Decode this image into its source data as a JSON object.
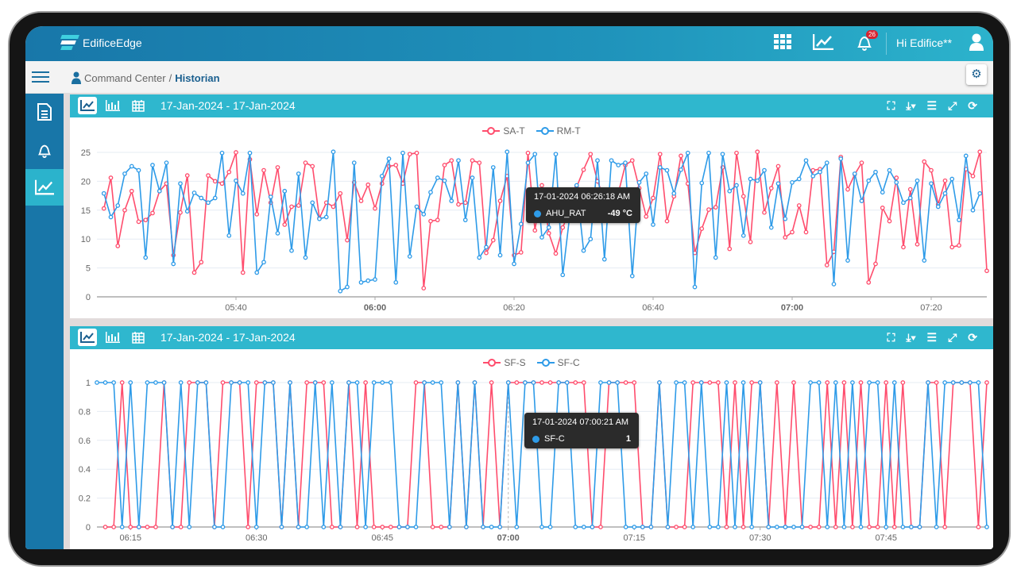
{
  "app": {
    "brand": "EdificeEdge",
    "greeting": "Hi Edifice**",
    "notification_count": "26"
  },
  "breadcrumb": {
    "parent": "Command Center",
    "separator": "/",
    "current": "Historian"
  },
  "colors": {
    "series_red": "#ff4d6d",
    "series_blue": "#2e9be8",
    "header": "#1877a9",
    "panel_header": "#2fb7ce"
  },
  "icons": {
    "topbar": [
      "grid-icon",
      "trend-chart-icon",
      "bell-icon",
      "user-icon"
    ],
    "sidebar": [
      "document-icon",
      "bell-icon",
      "trend-chart-icon"
    ],
    "panel_tools": [
      "fullscreen-icon",
      "download-icon",
      "list-icon",
      "expand-icon",
      "refresh-icon"
    ]
  },
  "panels": [
    {
      "date_range": "17-Jan-2024 - 17-Jan-2024",
      "legend": [
        "SA-T",
        "RM-T"
      ],
      "tooltip": {
        "time": "17-01-2024 06:26:18 AM",
        "series": "AHU_RAT",
        "value": "-49 °C"
      }
    },
    {
      "date_range": "17-Jan-2024 - 17-Jan-2024",
      "legend": [
        "SF-S",
        "SF-C"
      ],
      "tooltip": {
        "time": "17-01-2024 07:00:21 AM",
        "series": "SF-C",
        "value": "1"
      }
    }
  ],
  "chart_data": [
    {
      "type": "line",
      "xlim": [
        "05:20",
        "07:28"
      ],
      "ylim": [
        0,
        25
      ],
      "grid": true,
      "legend_position": "top",
      "yticks": [
        0,
        5,
        10,
        15,
        20,
        25
      ],
      "xticks": [
        "05:40",
        "06:00",
        "06:20",
        "06:40",
        "07:00",
        "07:20"
      ],
      "x": [
        "05:21",
        "05:22",
        "05:23",
        "05:24",
        "05:25",
        "05:26",
        "05:27",
        "05:28",
        "05:29",
        "05:30",
        "05:31",
        "05:32",
        "05:33",
        "05:34",
        "05:35",
        "05:36",
        "05:37",
        "05:38",
        "05:39",
        "05:40",
        "05:41",
        "05:42",
        "05:43",
        "05:44",
        "05:45",
        "05:46",
        "05:47",
        "05:48",
        "05:49",
        "05:50",
        "05:51",
        "05:52",
        "05:53",
        "05:54",
        "05:55",
        "05:56",
        "05:57",
        "05:58",
        "05:59",
        "06:00",
        "06:01",
        "06:02",
        "06:03",
        "06:04",
        "06:05",
        "06:06",
        "06:07",
        "06:08",
        "06:09",
        "06:10",
        "06:11",
        "06:12",
        "06:13",
        "06:14",
        "06:15",
        "06:16",
        "06:17",
        "06:18",
        "06:19",
        "06:20",
        "06:21",
        "06:22",
        "06:23",
        "06:24",
        "06:25",
        "06:26",
        "06:27",
        "06:28",
        "06:29",
        "06:30",
        "06:31",
        "06:32",
        "06:33",
        "06:34",
        "06:35",
        "06:36",
        "06:37",
        "06:38",
        "06:39",
        "06:40",
        "06:41",
        "06:42",
        "06:43",
        "06:44",
        "06:45",
        "06:46",
        "06:47",
        "06:48",
        "06:49",
        "06:50",
        "06:51",
        "06:52",
        "06:53",
        "06:54",
        "06:55",
        "06:56",
        "06:57",
        "06:58",
        "06:59",
        "07:00",
        "07:01",
        "07:02",
        "07:03",
        "07:04",
        "07:05",
        "07:06",
        "07:07",
        "07:08",
        "07:09",
        "07:10",
        "07:11",
        "07:12",
        "07:13",
        "07:14",
        "07:15",
        "07:16",
        "07:17",
        "07:18",
        "07:19",
        "07:20",
        "07:21",
        "07:22",
        "07:23",
        "07:24",
        "07:25",
        "07:26",
        "07:27",
        "07:28"
      ],
      "series": [
        {
          "name": "SA-T",
          "color": "#ff4d6d",
          "values": [
            15.3,
            20.6,
            8.8,
            15,
            18.3,
            13,
            13.3,
            14.5,
            18.3,
            19.6,
            7.2,
            14.6,
            21,
            4.2,
            6,
            21,
            20,
            19.6,
            21.6,
            25,
            4.2,
            23.8,
            14.3,
            21.9,
            16.3,
            22.4,
            12.5,
            15.6,
            15.8,
            23.2,
            22.6,
            13.6,
            16.3,
            15.6,
            17.9,
            9.8,
            19.8,
            16.6,
            19.4,
            15.3,
            19.6,
            22.6,
            22.8,
            19.6,
            24.7,
            24.9,
            1.5,
            13.1,
            13.3,
            22.8,
            23.6,
            16,
            16.3,
            23.6,
            23.2,
            7.6,
            9.8,
            16.6,
            20.9,
            7.2,
            7.7,
            24.9,
            11.5,
            19.3,
            11,
            7.5,
            12,
            15,
            19,
            22,
            24.7,
            20,
            17,
            16,
            18,
            22.8,
            23.6,
            18.8,
            13.9,
            17.1,
            24.7,
            13.1,
            17.4,
            24.4,
            19.6,
            7.6,
            11.8,
            15.1,
            15.5,
            22.4,
            8.3,
            24.9,
            17.4,
            9.5,
            25.1,
            14.6,
            18.8,
            22.6,
            10.3,
            11.2,
            15.8,
            11.2,
            21.9,
            22.1,
            5.5,
            7.8,
            24.2,
            18.6,
            21.2,
            23.2,
            2.5,
            5.7,
            15.4,
            13.1,
            20.6,
            8.6,
            18.6,
            9.1,
            23.4,
            21.9,
            16,
            20.1,
            8.6,
            8.9,
            22.1,
            20.9,
            25.1,
            4.5
          ]
        },
        {
          "name": "RM-T",
          "color": "#2e9be8",
          "values": [
            17.9,
            13.8,
            15.8,
            21.3,
            22.6,
            21.9,
            6.8,
            22.8,
            18.3,
            23.2,
            5.7,
            19.6,
            14.8,
            18,
            17.1,
            16.3,
            17.1,
            24.9,
            10.6,
            20.1,
            17.9,
            24.9,
            4.2,
            6,
            17.3,
            11,
            18.3,
            8,
            21.3,
            6.8,
            16.3,
            13.5,
            13.8,
            25.1,
            1,
            1.7,
            23.2,
            2.5,
            2.8,
            3,
            20.9,
            23.9,
            2.5,
            24.9,
            7,
            15.6,
            14.3,
            18.1,
            20.6,
            20.1,
            16.6,
            23.6,
            13.3,
            20.6,
            6.8,
            8.6,
            22.4,
            7.2,
            25.1,
            5.7,
            12.6,
            23.2,
            24.7,
            10.3,
            12,
            24.7,
            3.8,
            14,
            19.3,
            8,
            10,
            23.6,
            6.5,
            23.6,
            22.8,
            23.2,
            3.6,
            19.8,
            21.3,
            12.5,
            22.4,
            21.9,
            17.9,
            22,
            24.9,
            1.7,
            19.7,
            24.9,
            6.8,
            24.7,
            18.3,
            19.3,
            10.6,
            20.4,
            20.1,
            21.9,
            12,
            19.6,
            13.5,
            19.8,
            20.4,
            23.6,
            20.9,
            21.6,
            23.2,
            2.2,
            23.9,
            6.3,
            21.3,
            16.6,
            20.1,
            21.6,
            18.1,
            21.9,
            19.8,
            16.3,
            17.1,
            20.1,
            6.3,
            19.6,
            15.6,
            17.9,
            20.4,
            13.3,
            24.4,
            15,
            17.9,
            null
          ]
        }
      ]
    },
    {
      "type": "line",
      "xlim": [
        "06:11",
        "07:57"
      ],
      "ylim": [
        0,
        1
      ],
      "grid": true,
      "legend_position": "top",
      "yticks": [
        0,
        0.2,
        0.4,
        0.6,
        0.8,
        1
      ],
      "xticks": [
        "06:15",
        "06:30",
        "06:45",
        "07:00",
        "07:15",
        "07:30",
        "07:45"
      ],
      "x": [
        "06:11",
        "06:12",
        "06:13",
        "06:14",
        "06:15",
        "06:16",
        "06:17",
        "06:18",
        "06:19",
        "06:20",
        "06:21",
        "06:22",
        "06:23",
        "06:24",
        "06:25",
        "06:26",
        "06:27",
        "06:28",
        "06:29",
        "06:30",
        "06:31",
        "06:32",
        "06:33",
        "06:34",
        "06:35",
        "06:36",
        "06:37",
        "06:38",
        "06:39",
        "06:40",
        "06:41",
        "06:42",
        "06:43",
        "06:44",
        "06:45",
        "06:46",
        "06:47",
        "06:48",
        "06:49",
        "06:50",
        "06:51",
        "06:52",
        "06:53",
        "06:54",
        "06:55",
        "06:56",
        "06:57",
        "06:58",
        "06:59",
        "07:00",
        "07:01",
        "07:02",
        "07:03",
        "07:04",
        "07:05",
        "07:06",
        "07:07",
        "07:08",
        "07:09",
        "07:10",
        "07:11",
        "07:12",
        "07:13",
        "07:14",
        "07:15",
        "07:16",
        "07:17",
        "07:18",
        "07:19",
        "07:20",
        "07:21",
        "07:22",
        "07:23",
        "07:24",
        "07:25",
        "07:26",
        "07:27",
        "07:28",
        "07:29",
        "07:30",
        "07:31",
        "07:32",
        "07:33",
        "07:34",
        "07:35",
        "07:36",
        "07:37",
        "07:38",
        "07:39",
        "07:40",
        "07:41",
        "07:42",
        "07:43",
        "07:44",
        "07:45",
        "07:46",
        "07:47",
        "07:48",
        "07:49",
        "07:50",
        "07:51",
        "07:52",
        "07:53",
        "07:54",
        "07:55",
        "07:56",
        "07:57"
      ],
      "series": [
        {
          "name": "SF-S",
          "color": "#ff4d6d",
          "values": [
            null,
            0,
            0,
            1,
            0,
            0,
            0,
            0,
            1,
            0,
            0,
            1,
            1,
            1,
            0,
            1,
            1,
            1,
            0,
            1,
            1,
            1,
            0,
            1,
            0,
            1,
            1,
            1,
            0,
            0,
            1,
            0,
            1,
            0,
            0,
            0,
            0,
            0,
            1,
            1,
            0,
            0,
            0,
            1,
            0,
            1,
            0,
            1,
            0,
            1,
            1,
            1,
            1,
            1,
            1,
            1,
            1,
            1,
            1,
            0,
            0,
            1,
            1,
            1,
            1,
            0,
            0,
            1,
            0,
            0,
            0,
            1,
            1,
            1,
            1,
            0,
            1,
            0,
            1,
            1,
            0,
            1,
            0,
            1,
            0,
            0,
            0,
            1,
            0,
            1,
            0,
            1,
            0,
            0,
            1,
            0,
            1,
            0,
            0,
            1,
            1,
            0,
            1,
            1,
            1,
            0,
            1
          ]
        },
        {
          "name": "SF-C",
          "color": "#2e9be8",
          "values": [
            1,
            1,
            1,
            0,
            1,
            0,
            1,
            1,
            1,
            0,
            1,
            0,
            1,
            1,
            0,
            0,
            1,
            1,
            1,
            0,
            1,
            1,
            0,
            1,
            0,
            0,
            1,
            0,
            1,
            0,
            1,
            1,
            0,
            1,
            1,
            1,
            0,
            0,
            0,
            1,
            1,
            1,
            0,
            1,
            0,
            1,
            0,
            0,
            0,
            1,
            0,
            1,
            1,
            0,
            0,
            1,
            1,
            0,
            0,
            0,
            1,
            1,
            1,
            0,
            0,
            0,
            0,
            1,
            0,
            1,
            1,
            0,
            1,
            0,
            0,
            1,
            0,
            1,
            0,
            1,
            0,
            0,
            0,
            0,
            0,
            1,
            1,
            0,
            1,
            0,
            1,
            0,
            1,
            1,
            0,
            1,
            0,
            0,
            0,
            1,
            0,
            1,
            1,
            1,
            1,
            1,
            0
          ]
        }
      ]
    }
  ]
}
